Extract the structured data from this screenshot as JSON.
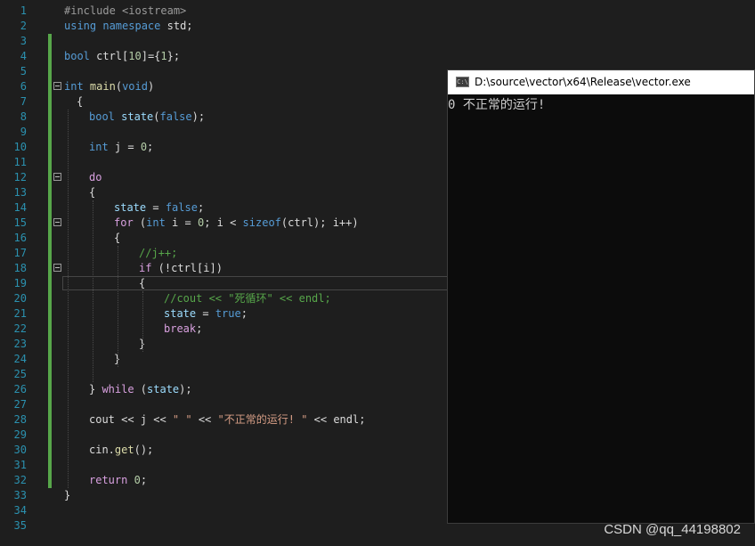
{
  "editor": {
    "lines": [
      {
        "n": "1",
        "segs": [
          {
            "t": "#include <iostream>",
            "c": "pp"
          }
        ]
      },
      {
        "n": "2",
        "segs": [
          {
            "t": "using",
            "c": "kw"
          },
          {
            "t": " "
          },
          {
            "t": "namespace",
            "c": "kw"
          },
          {
            "t": " std;"
          }
        ]
      },
      {
        "n": "3",
        "segs": []
      },
      {
        "n": "4",
        "segs": [
          {
            "t": "bool",
            "c": "ty"
          },
          {
            "t": " ctrl[",
            "c": ""
          },
          {
            "t": "10",
            "c": "num"
          },
          {
            "t": "]={"
          },
          {
            "t": "1",
            "c": "num"
          },
          {
            "t": "};"
          }
        ]
      },
      {
        "n": "5",
        "segs": []
      },
      {
        "n": "6",
        "segs": [
          {
            "t": "int",
            "c": "ty"
          },
          {
            "t": " "
          },
          {
            "t": "main",
            "c": "fn"
          },
          {
            "t": "("
          },
          {
            "t": "void",
            "c": "ty"
          },
          {
            "t": ")"
          }
        ]
      },
      {
        "n": "7",
        "segs": [
          {
            "t": "{"
          }
        ]
      },
      {
        "n": "8",
        "segs": [
          {
            "t": "bool",
            "c": "ty"
          },
          {
            "t": " "
          },
          {
            "t": "state",
            "c": "var"
          },
          {
            "t": "("
          },
          {
            "t": "false",
            "c": "kw"
          },
          {
            "t": ");"
          }
        ]
      },
      {
        "n": "9",
        "segs": []
      },
      {
        "n": "10",
        "segs": [
          {
            "t": "int",
            "c": "ty"
          },
          {
            "t": " j = "
          },
          {
            "t": "0",
            "c": "num"
          },
          {
            "t": ";"
          }
        ]
      },
      {
        "n": "11",
        "segs": []
      },
      {
        "n": "12",
        "segs": [
          {
            "t": "do",
            "c": "ctl"
          }
        ]
      },
      {
        "n": "13",
        "segs": [
          {
            "t": "{"
          }
        ]
      },
      {
        "n": "14",
        "segs": [
          {
            "t": "state",
            "c": "var"
          },
          {
            "t": " = "
          },
          {
            "t": "false",
            "c": "kw"
          },
          {
            "t": ";"
          }
        ]
      },
      {
        "n": "15",
        "segs": [
          {
            "t": "for",
            "c": "ctl"
          },
          {
            "t": " ("
          },
          {
            "t": "int",
            "c": "ty"
          },
          {
            "t": " i = "
          },
          {
            "t": "0",
            "c": "num"
          },
          {
            "t": "; i < "
          },
          {
            "t": "sizeof",
            "c": "kw"
          },
          {
            "t": "(ctrl); i++)"
          }
        ]
      },
      {
        "n": "16",
        "segs": [
          {
            "t": "{"
          }
        ]
      },
      {
        "n": "17",
        "segs": [
          {
            "t": "//j++;",
            "c": "cm"
          }
        ]
      },
      {
        "n": "18",
        "segs": [
          {
            "t": "if",
            "c": "ctl"
          },
          {
            "t": " (!ctrl[i])"
          }
        ]
      },
      {
        "n": "19",
        "segs": [
          {
            "t": "{"
          }
        ]
      },
      {
        "n": "20",
        "segs": [
          {
            "t": "//cout << \"死循环\" << endl;",
            "c": "cm"
          }
        ]
      },
      {
        "n": "21",
        "segs": [
          {
            "t": "state",
            "c": "var"
          },
          {
            "t": " = "
          },
          {
            "t": "true",
            "c": "kw"
          },
          {
            "t": ";"
          }
        ]
      },
      {
        "n": "22",
        "segs": [
          {
            "t": "break",
            "c": "ctl"
          },
          {
            "t": ";"
          }
        ]
      },
      {
        "n": "23",
        "segs": [
          {
            "t": "}"
          }
        ]
      },
      {
        "n": "24",
        "segs": [
          {
            "t": "}"
          }
        ]
      },
      {
        "n": "25",
        "segs": []
      },
      {
        "n": "26",
        "segs": [
          {
            "t": "} "
          },
          {
            "t": "while",
            "c": "ctl"
          },
          {
            "t": " ("
          },
          {
            "t": "state",
            "c": "var"
          },
          {
            "t": ");"
          }
        ]
      },
      {
        "n": "27",
        "segs": []
      },
      {
        "n": "28",
        "segs": [
          {
            "t": "cout << j << "
          },
          {
            "t": "\" \"",
            "c": "str"
          },
          {
            "t": " << "
          },
          {
            "t": "\"不正常的运行! \"",
            "c": "str"
          },
          {
            "t": " << endl;"
          }
        ]
      },
      {
        "n": "29",
        "segs": []
      },
      {
        "n": "30",
        "segs": [
          {
            "t": "cin."
          },
          {
            "t": "get",
            "c": "fn"
          },
          {
            "t": "();"
          }
        ]
      },
      {
        "n": "31",
        "segs": []
      },
      {
        "n": "32",
        "segs": [
          {
            "t": "return",
            "c": "ctl"
          },
          {
            "t": " "
          },
          {
            "t": "0",
            "c": "num"
          },
          {
            "t": ";"
          }
        ]
      },
      {
        "n": "33",
        "segs": [
          {
            "t": "}"
          }
        ]
      },
      {
        "n": "34",
        "segs": []
      },
      {
        "n": "35",
        "segs": []
      }
    ]
  },
  "console": {
    "title": "D:\\source\\vector\\x64\\Release\\vector.exe",
    "icon_label": "C:\\",
    "icon": "console-app-icon",
    "output": "0 不正常的运行!"
  },
  "watermark": "CSDN @qq_44198802",
  "colors": {
    "editor_bg": "#1e1e1e",
    "line_number": "#2b91af",
    "keyword": "#569cd6",
    "control": "#d8a0df",
    "comment": "#57a64a",
    "string": "#d69d85",
    "number": "#b5cea8",
    "change_bar": "#57a64a",
    "console_bg": "#0c0c0c"
  }
}
